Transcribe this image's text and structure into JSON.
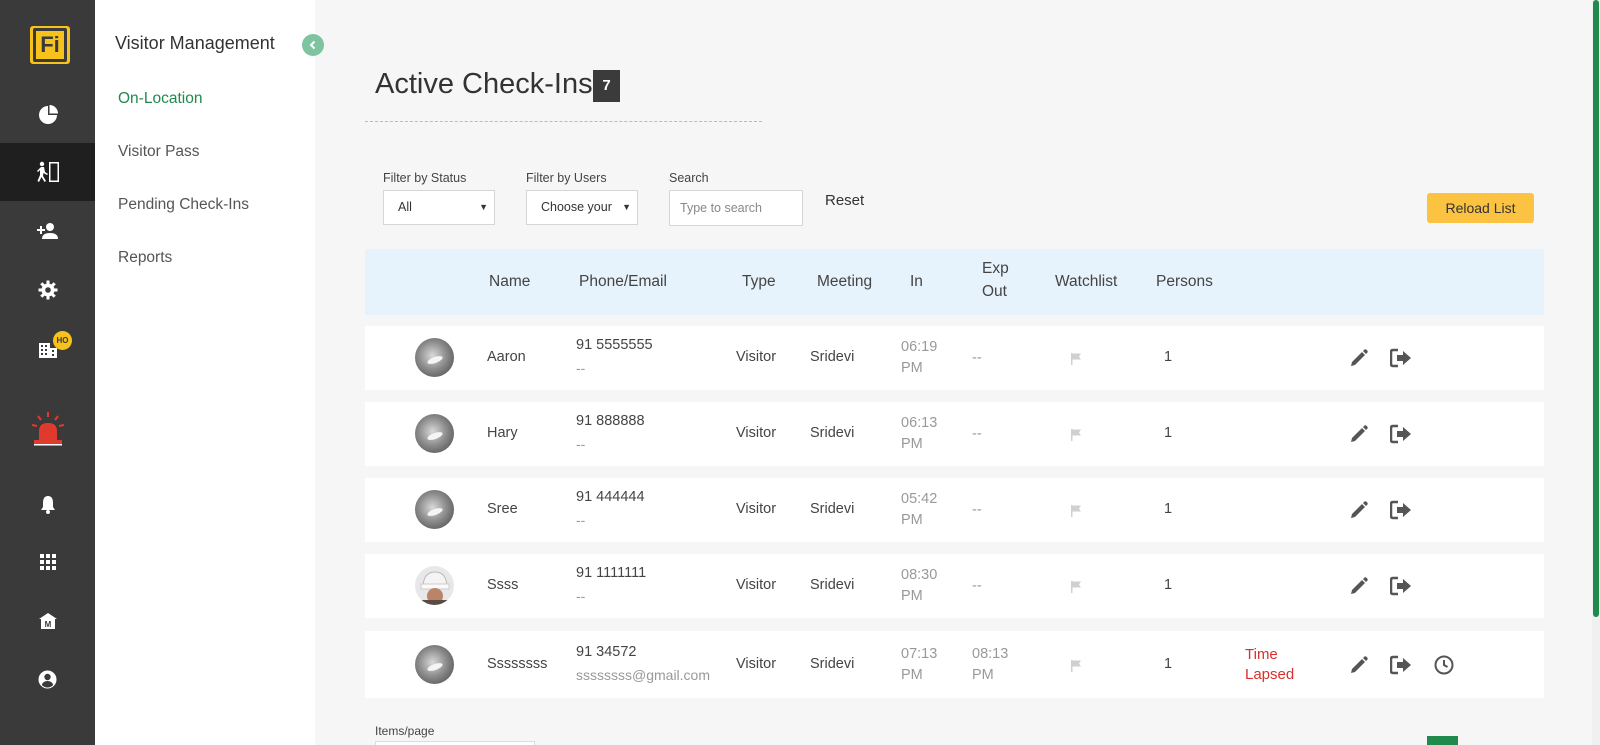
{
  "app": {
    "logo_text": "Fi",
    "accent_color": "#1f8a4c",
    "brand_color": "#f7c21b"
  },
  "rail": {
    "items": [
      {
        "icon": "pie-chart-icon"
      },
      {
        "icon": "visitor-door-icon",
        "active": true
      },
      {
        "icon": "add-user-icon"
      },
      {
        "icon": "gear-icon"
      },
      {
        "icon": "building-icon",
        "badge": "HO"
      },
      {
        "icon": "alarm-siren-icon"
      },
      {
        "icon": "bell-icon"
      },
      {
        "icon": "grid-icon"
      },
      {
        "icon": "home-m-icon"
      },
      {
        "icon": "account-icon"
      }
    ]
  },
  "subnav": {
    "title": "Visitor Management",
    "items": [
      {
        "label": "On-Location",
        "active": true
      },
      {
        "label": "Visitor Pass"
      },
      {
        "label": "Pending Check-Ins"
      },
      {
        "label": "Reports"
      }
    ]
  },
  "page": {
    "title": "Active Check-Ins",
    "count": "7"
  },
  "filters": {
    "status_label": "Filter by Status",
    "status_value": "All",
    "users_label": "Filter by Users",
    "users_value": "Choose your",
    "search_label": "Search",
    "search_placeholder": "Type to search",
    "reset_label": "Reset",
    "reload_label": "Reload List"
  },
  "table": {
    "headers": {
      "name": "Name",
      "phone": "Phone/Email",
      "type": "Type",
      "meeting": "Meeting",
      "in": "In",
      "exp_out_1": "Exp",
      "exp_out_2": "Out",
      "watchlist": "Watchlist",
      "persons": "Persons"
    },
    "rows": [
      {
        "name": "Aaron",
        "phone": "91 5555555",
        "email": "--",
        "type": "Visitor",
        "meeting": "Sridevi",
        "in_time": "06:19",
        "in_ampm": "PM",
        "exp_time": "--",
        "exp_ampm": "",
        "persons": "1",
        "status_1": "",
        "status_2": "",
        "has_clock": false,
        "avatar": "gray"
      },
      {
        "name": "Hary",
        "phone": "91 888888",
        "email": "--",
        "type": "Visitor",
        "meeting": "Sridevi",
        "in_time": "06:13",
        "in_ampm": "PM",
        "exp_time": "--",
        "exp_ampm": "",
        "persons": "1",
        "status_1": "",
        "status_2": "",
        "has_clock": false,
        "avatar": "gray"
      },
      {
        "name": "Sree",
        "phone": "91 444444",
        "email": "--",
        "type": "Visitor",
        "meeting": "Sridevi",
        "in_time": "05:42",
        "in_ampm": "PM",
        "exp_time": "--",
        "exp_ampm": "",
        "persons": "1",
        "status_1": "",
        "status_2": "",
        "has_clock": false,
        "avatar": "gray"
      },
      {
        "name": "Ssss",
        "phone": "91 1111111",
        "email": "--",
        "type": "Visitor",
        "meeting": "Sridevi",
        "in_time": "08:30",
        "in_ampm": "PM",
        "exp_time": "--",
        "exp_ampm": "",
        "persons": "1",
        "status_1": "",
        "status_2": "",
        "has_clock": false,
        "avatar": "person"
      },
      {
        "name": "Ssssssss",
        "phone": "91 34572",
        "email": "ssssssss@gmail.com",
        "type": "Visitor",
        "meeting": "Sridevi",
        "in_time": "07:13",
        "in_ampm": "PM",
        "exp_time": "08:13",
        "exp_ampm": "PM",
        "persons": "1",
        "status_1": "Time",
        "status_2": "Lapsed",
        "has_clock": true,
        "avatar": "gray"
      }
    ]
  },
  "pagination": {
    "items_label": "Items/page"
  }
}
